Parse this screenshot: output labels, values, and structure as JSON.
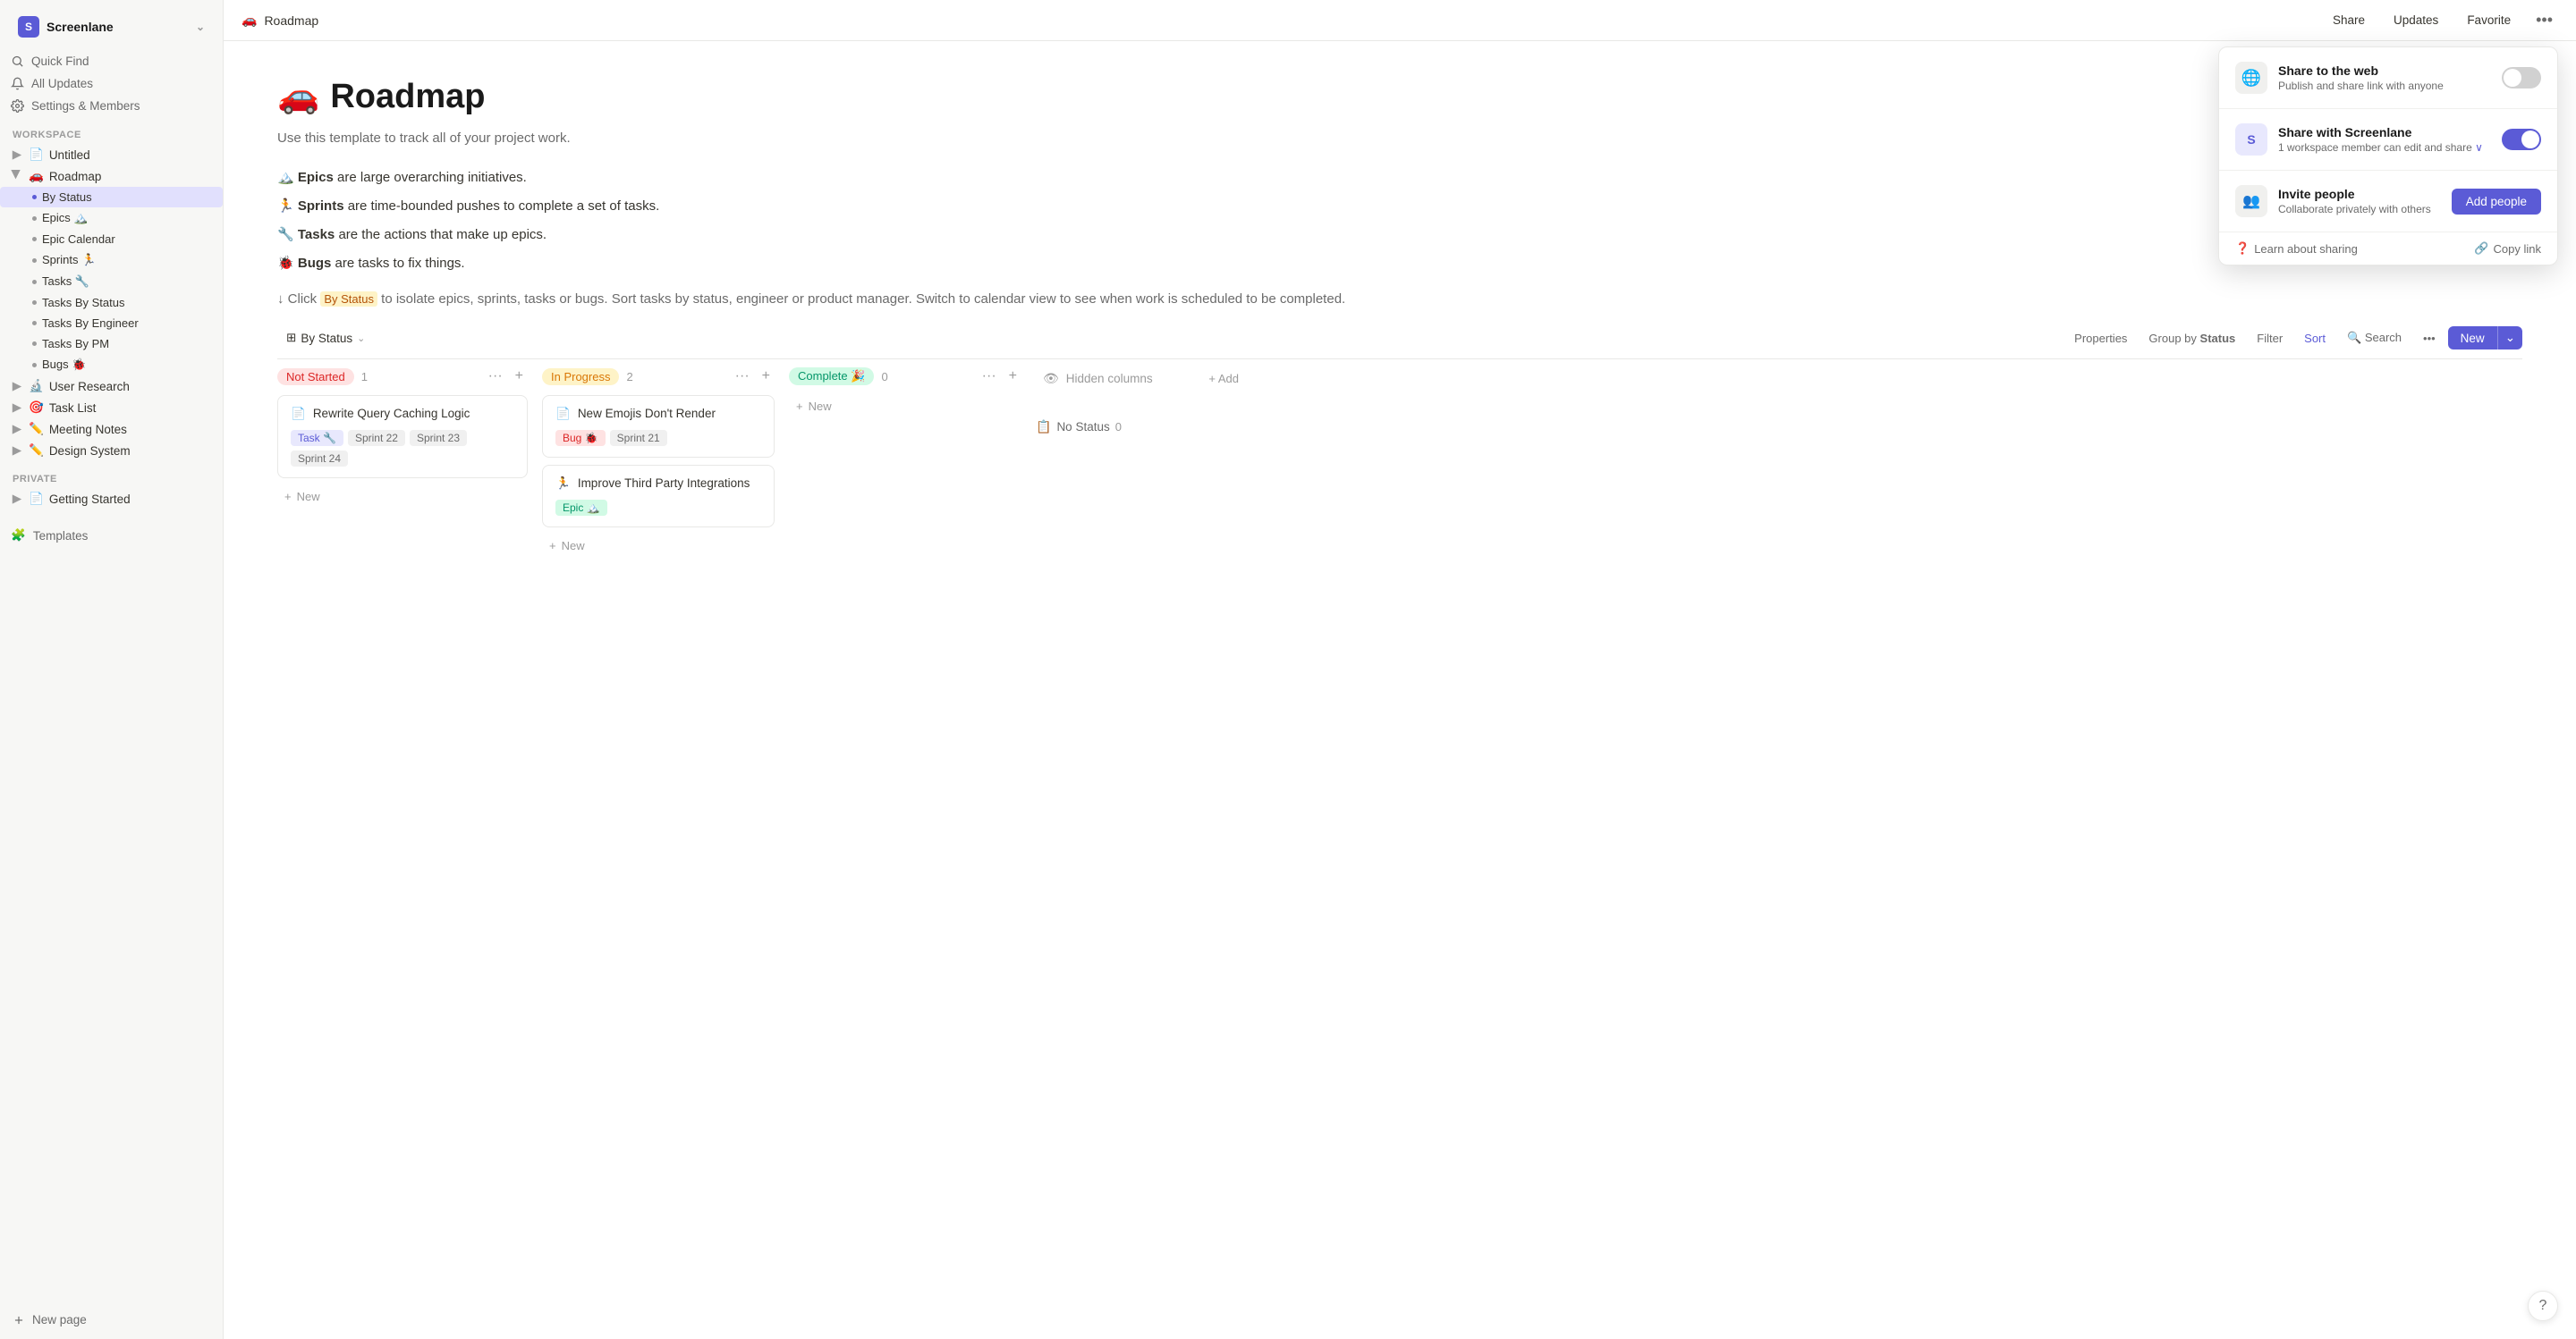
{
  "brand": {
    "icon": "S",
    "name": "Screenlane",
    "chevron": "⌄"
  },
  "sidebar_nav": [
    {
      "id": "quick-find",
      "label": "Quick Find",
      "icon": "search"
    },
    {
      "id": "all-updates",
      "label": "All Updates",
      "icon": "bell"
    },
    {
      "id": "settings",
      "label": "Settings & Members",
      "icon": "gear"
    }
  ],
  "workspace_label": "WORKSPACE",
  "workspace_items": [
    {
      "id": "untitled",
      "label": "Untitled",
      "icon": "📄",
      "expandable": true
    },
    {
      "id": "roadmap",
      "label": "Roadmap",
      "icon": "🚗",
      "expandable": true,
      "expanded": true
    }
  ],
  "roadmap_subitems": [
    {
      "id": "by-status",
      "label": "By Status",
      "active": true
    },
    {
      "id": "epics",
      "label": "Epics 🏔️"
    },
    {
      "id": "epic-calendar",
      "label": "Epic Calendar"
    },
    {
      "id": "sprints",
      "label": "Sprints 🏃"
    },
    {
      "id": "tasks",
      "label": "Tasks 🔧"
    },
    {
      "id": "tasks-by-status",
      "label": "Tasks By Status"
    },
    {
      "id": "tasks-by-engineer",
      "label": "Tasks By Engineer"
    },
    {
      "id": "tasks-by-pm",
      "label": "Tasks By PM"
    },
    {
      "id": "bugs",
      "label": "Bugs 🐞"
    }
  ],
  "workspace_items2": [
    {
      "id": "user-research",
      "label": "User Research",
      "icon": "🔬",
      "expandable": true
    },
    {
      "id": "task-list",
      "label": "Task List",
      "icon": "🎯",
      "expandable": true
    },
    {
      "id": "meeting-notes",
      "label": "Meeting Notes",
      "icon": "✏️",
      "expandable": true
    },
    {
      "id": "design-system",
      "label": "Design System",
      "icon": "✏️",
      "expandable": true
    }
  ],
  "private_label": "PRIVATE",
  "private_items": [
    {
      "id": "getting-started",
      "label": "Getting Started",
      "icon": "📄",
      "expandable": true
    }
  ],
  "templates_label": "Templates",
  "new_page_label": "+ New page",
  "topbar": {
    "page_icon": "🚗",
    "page_title": "Roadmap",
    "share_btn": "Share",
    "updates_btn": "Updates",
    "favorite_btn": "Favorite",
    "dots": "•••"
  },
  "page": {
    "title_icon": "🚗",
    "title": "Roadmap",
    "description": "Use this template to track all of your project work.",
    "body": [
      {
        "emoji": "🏔️",
        "bold": "Epics",
        "rest": " are large overarching initiatives."
      },
      {
        "emoji": "🏃",
        "bold": "Sprints",
        "rest": " are time-bounded pushes to complete a set of tasks."
      },
      {
        "emoji": "🔧",
        "bold": "Tasks",
        "rest": " are the actions that make up epics."
      },
      {
        "emoji": "🐞",
        "bold": "Bugs",
        "rest": " are tasks to fix things."
      }
    ],
    "arrow_text": "↓ Click",
    "highlight": "By Status",
    "arrow_text_rest": " to isolate epics, sprints, tasks or bugs. Sort tasks by status, engineer or product manager. Switch to calendar view to see when work is scheduled to be completed."
  },
  "db_toolbar": {
    "view_icon": "⊞",
    "view_label": "By Status",
    "view_chevron": "⌄",
    "properties_btn": "Properties",
    "group_by_label": "Group by",
    "group_by_value": "Status",
    "filter_btn": "Filter",
    "sort_btn": "Sort",
    "search_btn": "Search",
    "more_btn": "•••",
    "new_btn": "New",
    "new_arrow": "⌄"
  },
  "kanban": {
    "columns": [
      {
        "id": "not-started",
        "status": "Not Started",
        "badge_class": "badge-not-started",
        "count": 1,
        "cards": [
          {
            "id": "card-1",
            "icon": "📄",
            "title": "Rewrite Query Caching Logic",
            "tags": [
              {
                "label": "Task 🔧",
                "class": "tag-task"
              },
              {
                "label": "Sprint 22",
                "class": "tag-sprint"
              },
              {
                "label": "Sprint 23",
                "class": "tag-sprint"
              },
              {
                "label": "Sprint 24",
                "class": "tag-sprint"
              }
            ]
          }
        ],
        "add_label": "New"
      },
      {
        "id": "in-progress",
        "status": "In Progress",
        "badge_class": "badge-in-progress",
        "count": 2,
        "cards": [
          {
            "id": "card-2",
            "icon": "📄",
            "title": "New Emojis Don't Render",
            "tags": [
              {
                "label": "Bug 🐞",
                "class": "tag-bug"
              },
              {
                "label": "Sprint 21",
                "class": "tag-sprint"
              }
            ]
          },
          {
            "id": "card-3",
            "icon": "🏃",
            "title": "Improve Third Party Integrations",
            "tags": [
              {
                "label": "Epic 🏔️",
                "class": "tag-epic"
              }
            ]
          }
        ],
        "add_label": "New"
      },
      {
        "id": "complete",
        "status": "Complete 🎉",
        "badge_class": "badge-complete",
        "count": 0,
        "cards": [],
        "add_label": "New"
      }
    ],
    "hidden_col_label": "Hidden columns",
    "hidden_add_label": "+ Add",
    "no_status_label": "No Status",
    "no_status_count": 0,
    "add_new_label": "+ New"
  },
  "share_popup": {
    "title": "Share to the web",
    "subtitle": "Publish and share link with anyone",
    "toggle_on": false,
    "share_screenlane_title": "Share with Screenlane",
    "share_screenlane_subtitle": "1 workspace member can edit and share",
    "share_screenlane_toggle": true,
    "invite_title": "Invite people",
    "invite_subtitle": "Collaborate privately with others",
    "add_people_btn": "Add people",
    "learn_link": "Learn about sharing",
    "copy_link": "Copy link"
  },
  "help_btn": "?"
}
